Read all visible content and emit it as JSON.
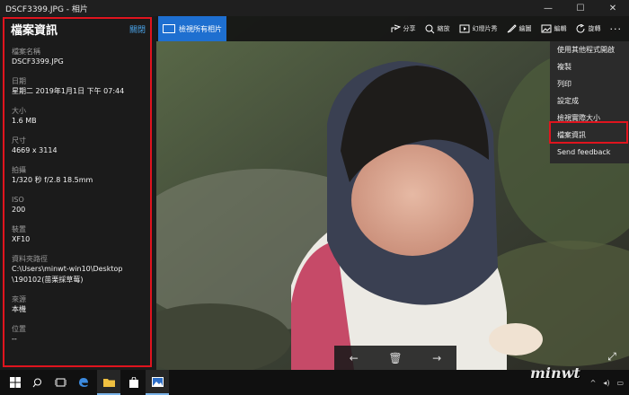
{
  "window": {
    "title": "DSCF3399.JPG - 相片",
    "minimize": "—",
    "maximize": "☐",
    "close": "✕"
  },
  "info_panel": {
    "title": "檔案資訊",
    "close_label": "關閉",
    "fields": [
      {
        "label": "檔案名稱",
        "value": "DSCF3399.JPG"
      },
      {
        "label": "日期",
        "value": "星期二 2019年1月1日 下午 07:44"
      },
      {
        "label": "大小",
        "value": "1.6 MB"
      },
      {
        "label": "尺寸",
        "value": "4669 x 3114"
      },
      {
        "label": "拍攝",
        "value": "1/320 秒 f/2.8 18.5mm"
      },
      {
        "label": "ISO",
        "value": "200"
      },
      {
        "label": "裝置",
        "value": "XF10"
      },
      {
        "label": "資料夾路徑",
        "value": "C:\\Users\\minwt-win10\\Desktop\n\\190102(苗栗採草莓)"
      },
      {
        "label": "來源",
        "value": "本機"
      },
      {
        "label": "位置",
        "value": "--"
      }
    ]
  },
  "toolbar": {
    "view_all": "檢視所有相片",
    "share": "分享",
    "zoom": "縮放",
    "slideshow": "幻燈片秀",
    "draw": "繪圖",
    "edit": "編輯",
    "rotate": "旋轉",
    "more": "···"
  },
  "menu": {
    "items": [
      "使用其他程式開啟",
      "複製",
      "列印",
      "設定成",
      "檢視實際大小",
      "檔案資訊",
      "Send feedback"
    ]
  },
  "nav": {
    "prev": "←",
    "delete": "🗑",
    "next": "→"
  },
  "watermark": "minwt"
}
